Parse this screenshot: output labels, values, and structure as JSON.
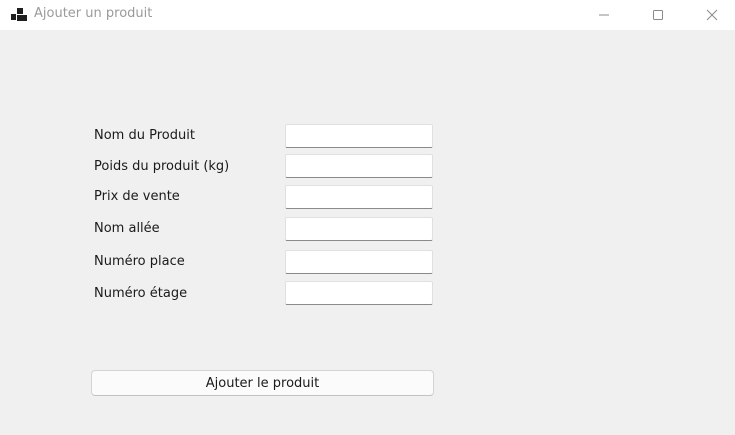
{
  "window": {
    "title": "Ajouter un produit",
    "icon": "app-window-icon",
    "controls": {
      "minimize_icon": "minimize-icon",
      "maximize_icon": "maximize-icon",
      "close_icon": "close-icon"
    }
  },
  "form": {
    "fields": [
      {
        "label": "Nom du Produit",
        "value": "",
        "placeholder": ""
      },
      {
        "label": "Poids du produit (kg)",
        "value": "",
        "placeholder": ""
      },
      {
        "label": "Prix de vente",
        "value": "",
        "placeholder": ""
      },
      {
        "label": "Nom allée",
        "value": "",
        "placeholder": ""
      },
      {
        "label": "Numéro place",
        "value": "",
        "placeholder": ""
      },
      {
        "label": "Numéro étage",
        "value": "",
        "placeholder": ""
      }
    ],
    "submit_label": "Ajouter le produit"
  },
  "colors": {
    "window_background": "#f0f0f0",
    "titlebar_background": "#ffffff",
    "title_text": "#9a9a9a"
  }
}
